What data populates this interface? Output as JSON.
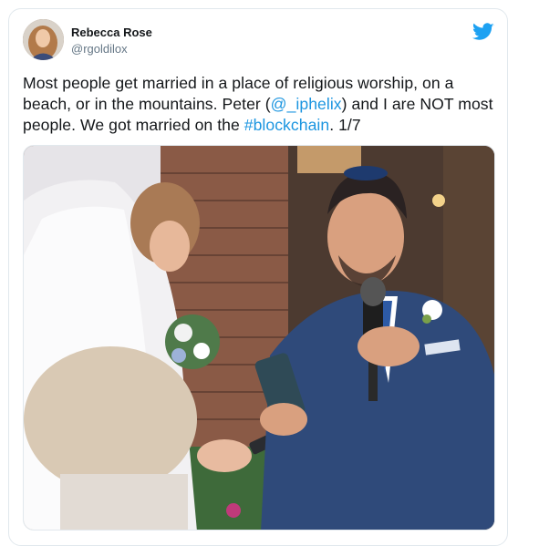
{
  "tweet": {
    "author": {
      "display_name": "Rebecca Rose",
      "handle": "@rgoldilox"
    },
    "text": {
      "part1": "Most people get married in a place of religious worship, on a beach, or in the mountains. Peter (",
      "mention": "@_iphelix",
      "part2": ") and I are NOT most people. We got married on the ",
      "hashtag": "#blockchain",
      "part3": ". 1/7"
    },
    "media": {
      "icon": "wedding-photo"
    }
  },
  "icons": {
    "brand": "twitter-bird-icon",
    "brand_color": "#1da1f2"
  },
  "colors": {
    "link": "#1b95e0",
    "border": "#e1e8ed",
    "handle": "#657786"
  }
}
